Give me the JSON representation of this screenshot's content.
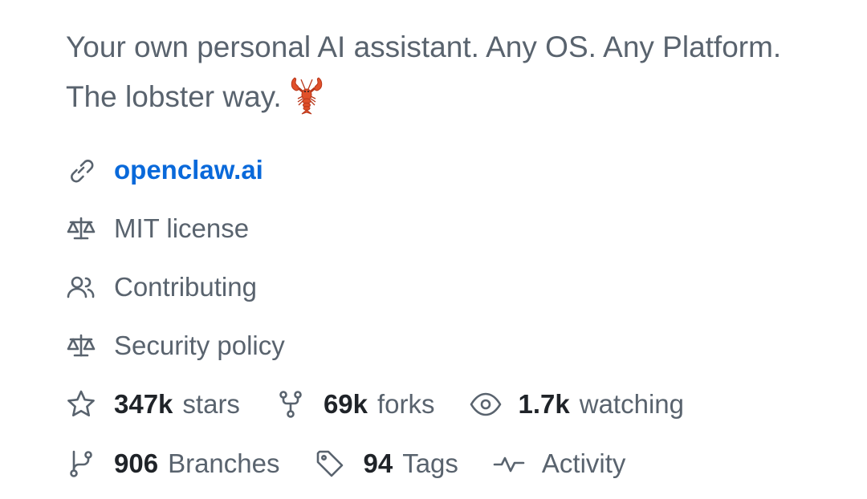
{
  "about": {
    "description": "Your own personal AI assistant. Any OS. Any Platform. The lobster way.",
    "description_emoji": "lobster-emoji"
  },
  "links": {
    "website": {
      "icon": "link-icon",
      "label": "openclaw.ai"
    },
    "license": {
      "icon": "law-icon",
      "label": "MIT license"
    },
    "contributing": {
      "icon": "people-icon",
      "label": "Contributing"
    },
    "security": {
      "icon": "law-icon",
      "label": "Security policy"
    }
  },
  "stats": {
    "stars": {
      "icon": "star-icon",
      "count": "347k",
      "label": "stars"
    },
    "forks": {
      "icon": "repo-forked-icon",
      "count": "69k",
      "label": "forks"
    },
    "watching": {
      "icon": "eye-icon",
      "count": "1.7k",
      "label": "watching"
    }
  },
  "meta": {
    "branches": {
      "icon": "git-branch-icon",
      "count": "906",
      "label": "Branches"
    },
    "tags": {
      "icon": "tag-icon",
      "count": "94",
      "label": "Tags"
    },
    "activity": {
      "icon": "pulse-icon",
      "label": "Activity"
    }
  },
  "colors": {
    "text_muted": "#59636e",
    "text_strong": "#1f2328",
    "link": "#0969da",
    "lobster": "#e0502a"
  }
}
